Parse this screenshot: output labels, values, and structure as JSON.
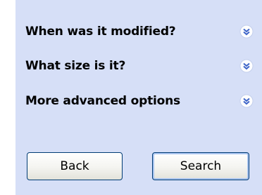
{
  "options": [
    {
      "label": "When was it modified?",
      "icon": "chevron-double-down-icon"
    },
    {
      "label": "What size is it?",
      "icon": "chevron-double-down-icon"
    },
    {
      "label": "More advanced options",
      "icon": "chevron-double-down-icon"
    }
  ],
  "buttons": {
    "back_label": "Back",
    "search_label": "Search"
  },
  "colors": {
    "panel_background": "#d6dff7",
    "icon_circle": "#ffffff",
    "icon_chevron": "#3d64c8",
    "button_border": "#003c74"
  }
}
